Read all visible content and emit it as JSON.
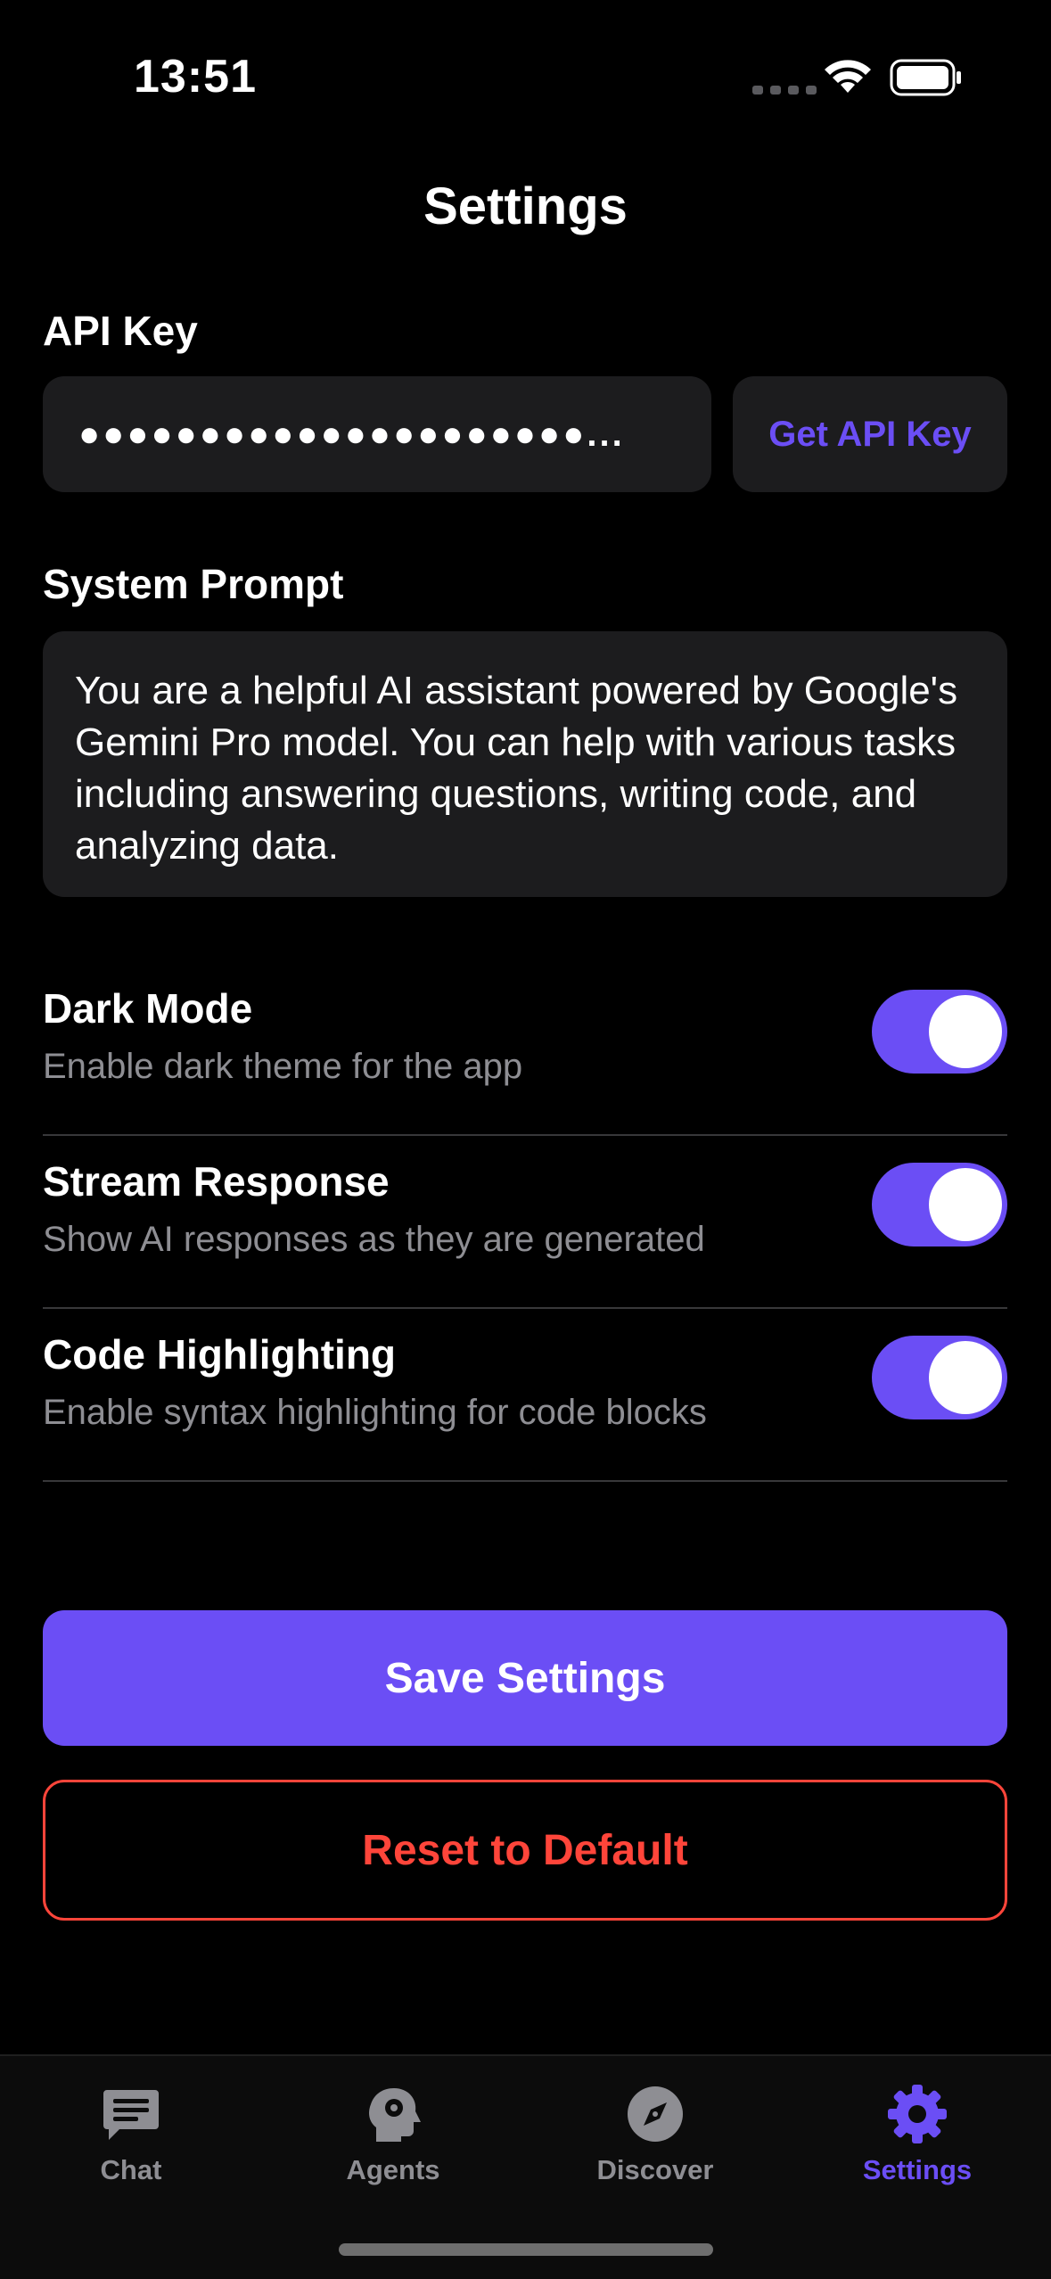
{
  "status_bar": {
    "time": "13:51",
    "icons": [
      "cellular-dots-icon",
      "wifi-icon",
      "battery-icon"
    ]
  },
  "header": {
    "title": "Settings"
  },
  "api_key": {
    "label": "API Key",
    "value_masked": "●●●●●●●●●●●●●●●●●●●●●...",
    "button_label": "Get API Key"
  },
  "system_prompt": {
    "label": "System Prompt",
    "text": "You are a helpful AI assistant powered by Google's Gemini Pro model. You can help with various tasks including answering questions, writing code, and analyzing data."
  },
  "toggles": [
    {
      "title": "Dark Mode",
      "description": "Enable dark theme for the app",
      "enabled": true
    },
    {
      "title": "Stream Response",
      "description": "Show AI responses as they are generated",
      "enabled": true
    },
    {
      "title": "Code Highlighting",
      "description": "Enable syntax highlighting for code blocks",
      "enabled": true
    }
  ],
  "actions": {
    "save_label": "Save Settings",
    "reset_label": "Reset to Default"
  },
  "tab_bar": {
    "tabs": [
      {
        "label": "Chat",
        "icon": "chat-bubble-icon",
        "active": false
      },
      {
        "label": "Agents",
        "icon": "head-gear-icon",
        "active": false
      },
      {
        "label": "Discover",
        "icon": "compass-icon",
        "active": false
      },
      {
        "label": "Settings",
        "icon": "gear-icon",
        "active": true
      }
    ]
  },
  "colors": {
    "accent": "#6b4ef5",
    "danger": "#ff453a",
    "background": "#000000",
    "surface": "#1c1c1e",
    "secondary_text": "#8e8e93"
  }
}
